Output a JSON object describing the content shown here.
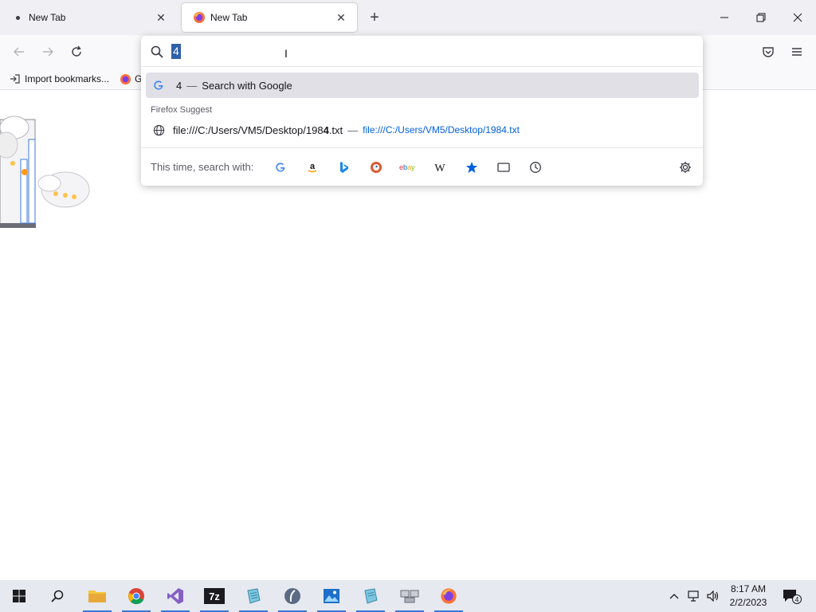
{
  "browser": {
    "tabs": [
      {
        "title": "New Tab",
        "active": false
      },
      {
        "title": "New Tab",
        "active": true
      }
    ]
  },
  "bookmarks": {
    "items": [
      {
        "label": "Import bookmarks..."
      },
      {
        "label": "G"
      }
    ]
  },
  "urlbar": {
    "typed_value": "4",
    "suggestions": {
      "search": {
        "query": "4",
        "separator": "—",
        "action": "Search with Google"
      },
      "group_label": "Firefox Suggest",
      "file": {
        "title_prefix": "file:///C:/Users/VM5/Desktop/198",
        "title_match": "4",
        "title_suffix": ".txt",
        "separator": "—",
        "url": "file:///C:/Users/VM5/Desktop/1984.txt"
      }
    },
    "one_off": {
      "label": "This time, search with:",
      "engines": [
        "google-icon",
        "amazon-icon",
        "bing-icon",
        "duckduckgo-icon",
        "ebay-icon",
        "wikipedia-icon",
        "bookmarks-star-icon",
        "tabs-icon",
        "history-icon"
      ],
      "settings_icon": "gear-icon"
    }
  },
  "taskbar": {
    "clock": {
      "time": "8:17 AM",
      "date": "2/2/2023"
    },
    "notification_count": "4",
    "accent": "#3c78d8"
  },
  "colors": {
    "tabstrip": "#f0f0f4",
    "selection": "#2f5fa8",
    "link": "#0060df",
    "highlight_row": "#e0e0e6"
  }
}
